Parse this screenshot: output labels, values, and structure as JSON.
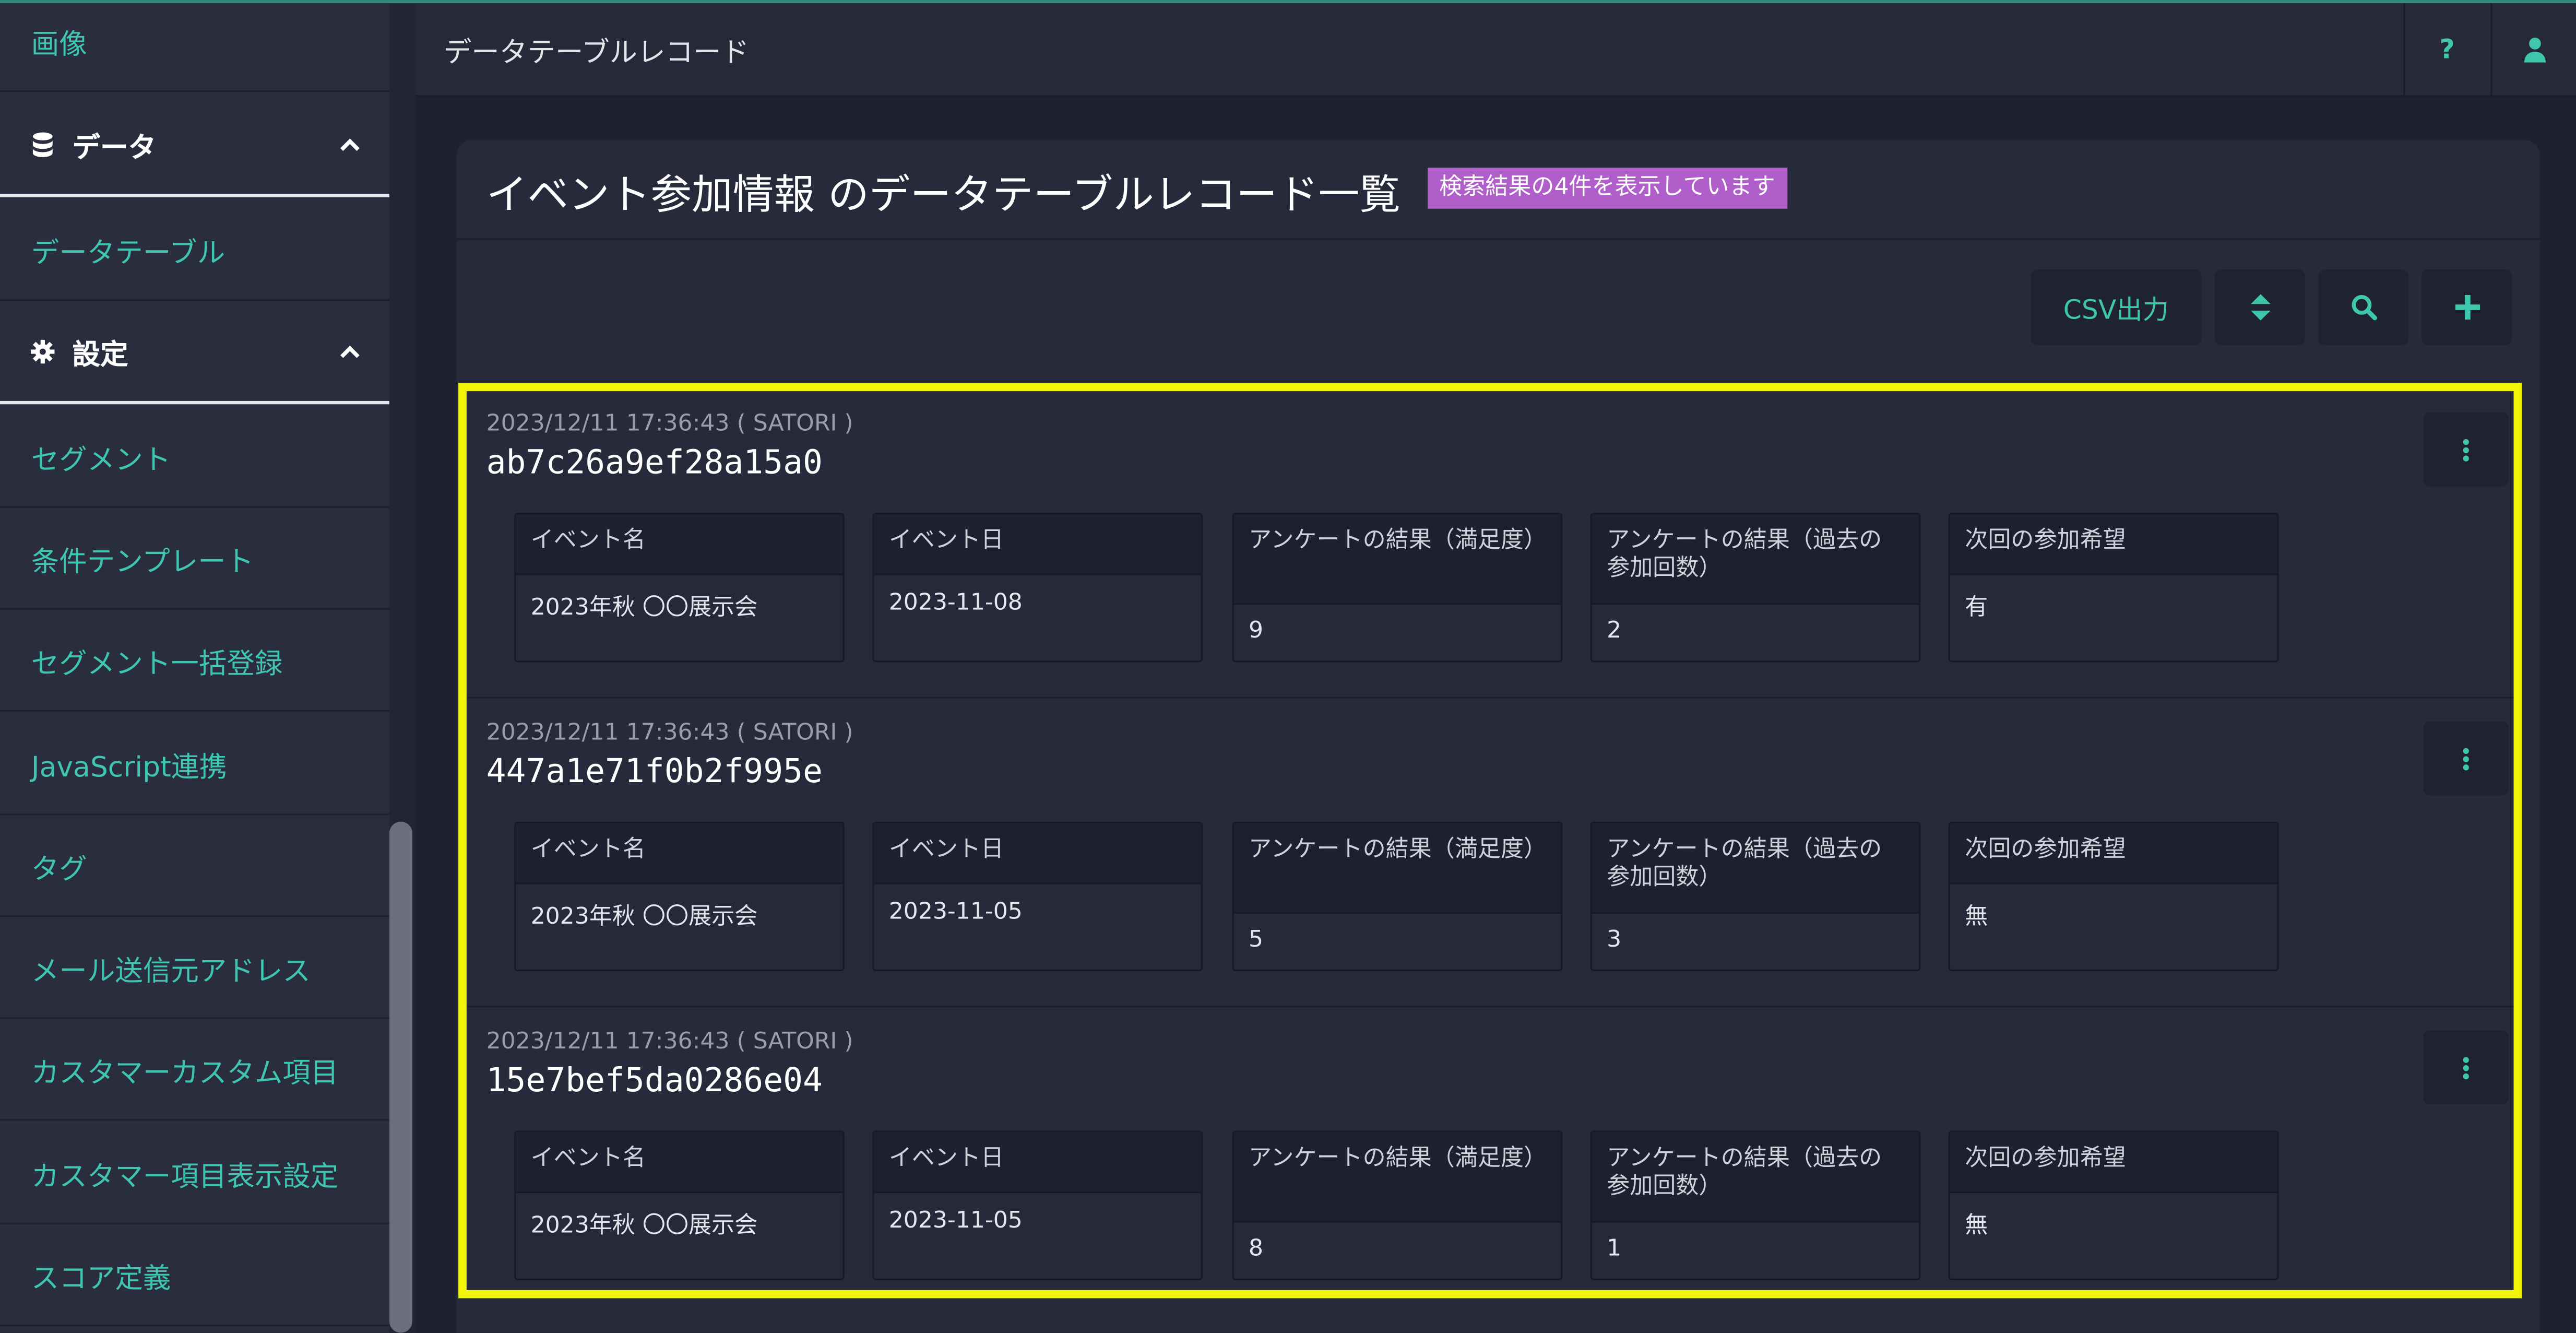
{
  "header": {
    "title": "データテーブルレコード",
    "help": "?",
    "user_icon": "user-icon"
  },
  "sidebar": {
    "items_top": [
      "画像"
    ],
    "group_data": {
      "label": "データ",
      "icon": "database-icon",
      "items": [
        "データテーブル"
      ]
    },
    "group_settings": {
      "label": "設定",
      "icon": "gear-icon",
      "items": [
        "セグメント",
        "条件テンプレート",
        "セグメント一括登録",
        "JavaScript連携",
        "タグ",
        "メール送信元アドレス",
        "カスタマーカスタム項目",
        "カスタマー項目表示設定",
        "スコア定義"
      ]
    }
  },
  "panel": {
    "title": "イベント参加情報 のデータテーブルレコード一覧",
    "badge": "検索結果の4件を表示しています",
    "toolbar": {
      "csv_label": "CSV出力",
      "sort_icon": "sort-icon",
      "search_icon": "search-icon",
      "add_icon": "plus-icon"
    }
  },
  "fields": [
    "イベント名",
    "イベント日",
    "アンケートの結果（満足度）",
    "アンケートの結果（過去の参加回数）",
    "次回の参加希望"
  ],
  "records": [
    {
      "meta": "2023/12/11 17:36:43 ( SATORI )",
      "id": "ab7c26a9ef28a15a0",
      "values": [
        "2023年秋 〇〇展示会",
        "2023-11-08",
        "9",
        "2",
        "有"
      ]
    },
    {
      "meta": "2023/12/11 17:36:43 ( SATORI )",
      "id": "447a1e71f0b2f995e",
      "values": [
        "2023年秋 〇〇展示会",
        "2023-11-05",
        "5",
        "3",
        "無"
      ]
    },
    {
      "meta": "2023/12/11 17:36:43 ( SATORI )",
      "id": "15e7bef5da0286e04",
      "values": [
        "2023年秋 〇〇展示会",
        "2023-11-05",
        "8",
        "1",
        "無"
      ]
    }
  ],
  "colors": {
    "accent": "#3fc7ae",
    "badge": "#b05ec9",
    "highlight": "#f4f40b",
    "background": "#1e2130"
  }
}
